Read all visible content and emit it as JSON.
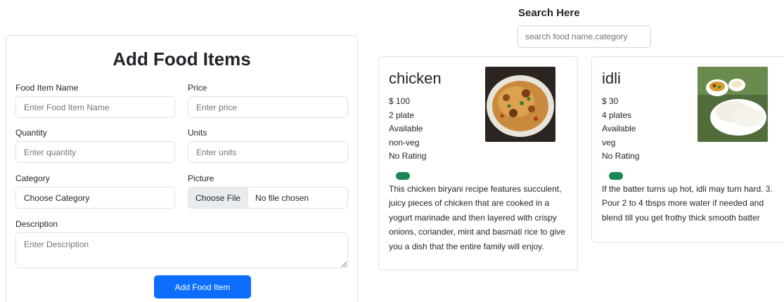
{
  "search": {
    "title": "Search Here",
    "placeholder": "search food name,category"
  },
  "form": {
    "title": "Add Food Items",
    "fields": {
      "name": {
        "label": "Food Item Name",
        "placeholder": "Enter Food Item Name"
      },
      "price": {
        "label": "Price",
        "placeholder": "Enter price"
      },
      "quantity": {
        "label": "Quantity",
        "placeholder": "Enter quantity"
      },
      "units": {
        "label": "Units",
        "placeholder": "Enter units"
      },
      "category": {
        "label": "Category",
        "value": "Choose Category"
      },
      "picture": {
        "label": "Picture",
        "button": "Choose File",
        "status": "No file chosen"
      },
      "description": {
        "label": "Description",
        "placeholder": "Enter Description"
      }
    },
    "submit_label": "Add Food Item"
  },
  "food_items": [
    {
      "name": "chicken",
      "price": "$ 100",
      "quantity": "2 plate",
      "availability": "Available",
      "type": "non-veg",
      "rating": "No Rating",
      "badge_color": "#198754",
      "image": "chicken-biryani-photo",
      "description": "This chicken biryani recipe features succulent, juicy pieces of chicken that are cooked in a yogurt marinade and then layered with crispy onions, coriander, mint and basmati rice to give you a dish that the entire family will enjoy."
    },
    {
      "name": "idli",
      "price": "$ 30",
      "quantity": "4 plates",
      "availability": "Available",
      "type": "veg",
      "rating": "No Rating",
      "badge_color": "#198754",
      "image": "idli-photo",
      "description": "If the batter turns up hot, idli may turn hard. 3. Pour 2 to 4 tbsps more water if needed and blend till you get frothy thick smooth batter"
    }
  ],
  "colors": {
    "primary": "#0d6efd",
    "success": "#198754",
    "border": "#dee2e6"
  }
}
